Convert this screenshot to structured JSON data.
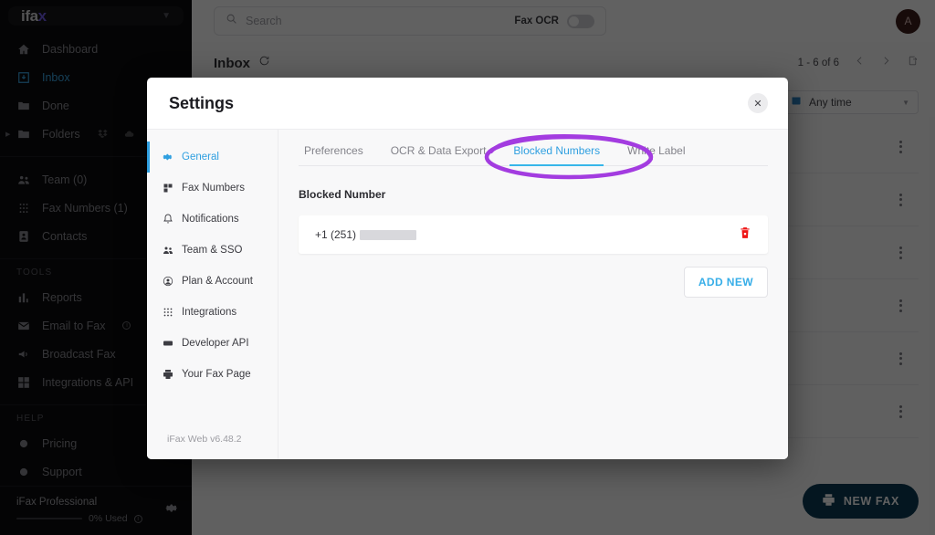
{
  "sidebar": {
    "logo": {
      "prefix": "ifa",
      "accent": "x",
      "chevron_icon": "chevron-down-icon"
    },
    "items": [
      {
        "label": "Dashboard",
        "icon": "home-icon",
        "active": false
      },
      {
        "label": "Inbox",
        "icon": "inbox-download-icon",
        "active": true
      },
      {
        "label": "Done",
        "icon": "folder-check-icon",
        "active": false
      },
      {
        "label": "Folders",
        "icon": "folder-icon",
        "active": false,
        "expandable": true,
        "badges": [
          "dropbox-icon",
          "cloud-icon"
        ]
      },
      {
        "label": "Team (0)",
        "icon": "team-icon",
        "active": false
      },
      {
        "label": "Fax Numbers (1)",
        "icon": "keypad-icon",
        "active": false
      },
      {
        "label": "Contacts",
        "icon": "contact-card-icon",
        "active": false
      }
    ],
    "tools_label": "TOOLS",
    "tools": [
      {
        "label": "Reports",
        "icon": "bar-chart-icon"
      },
      {
        "label": "Email to Fax",
        "icon": "envelope-icon",
        "info": true
      },
      {
        "label": "Broadcast Fax",
        "icon": "megaphone-icon"
      },
      {
        "label": "Integrations & API",
        "icon": "puzzle-icon"
      }
    ],
    "help_label": "HELP",
    "help": [
      {
        "label": "Pricing",
        "icon": "tag-icon"
      },
      {
        "label": "Support",
        "icon": "help-icon"
      }
    ],
    "plan": {
      "name": "iFax Professional",
      "usage": "0% Used",
      "settings_icon": "gear-icon",
      "info_icon": "info-icon"
    }
  },
  "topbar": {
    "search_placeholder": "Search",
    "search_icon": "search-icon",
    "ocr_label": "Fax OCR",
    "ocr_enabled": false,
    "avatar_initial": "A"
  },
  "inbox": {
    "title": "Inbox",
    "refresh_icon": "refresh-icon",
    "pagination": "1 - 6 of 6",
    "prev_icon": "chevron-left-icon",
    "next_icon": "chevron-right-icon",
    "export_icon": "export-icon",
    "date_filter": {
      "value": "Any time",
      "icon": "calendar-icon",
      "chevron": "chevron-down-icon"
    },
    "row_count": 6,
    "row_menu_icon": "kebab-menu-icon",
    "new_fax_label": "NEW FAX",
    "new_fax_icon": "fax-machine-icon"
  },
  "modal": {
    "title": "Settings",
    "close_icon": "close-icon",
    "nav": [
      {
        "label": "General",
        "icon": "gear-icon",
        "active": true
      },
      {
        "label": "Fax Numbers",
        "icon": "fax-numbers-icon",
        "active": false
      },
      {
        "label": "Notifications",
        "icon": "bell-icon",
        "active": false
      },
      {
        "label": "Team & SSO",
        "icon": "team-icon",
        "active": false
      },
      {
        "label": "Plan & Account",
        "icon": "user-circle-icon",
        "active": false
      },
      {
        "label": "Integrations",
        "icon": "grid-dots-icon",
        "active": false
      },
      {
        "label": "Developer API",
        "icon": "api-icon",
        "active": false
      },
      {
        "label": "Your Fax Page",
        "icon": "printer-icon",
        "active": false
      }
    ],
    "version": "iFax Web v6.48.2",
    "tabs": [
      {
        "label": "Preferences",
        "active": false
      },
      {
        "label": "OCR & Data Export",
        "active": false
      },
      {
        "label": "Blocked Numbers",
        "active": true
      },
      {
        "label": "White Label",
        "active": false
      }
    ],
    "blocked": {
      "section_label": "Blocked Number",
      "entries": [
        {
          "number_prefix": "+1 (251)",
          "redacted": true,
          "delete_icon": "trash-icon"
        }
      ],
      "add_label": "ADD NEW"
    }
  },
  "annotation": {
    "shape": "ellipse-highlight",
    "color": "#a33ce0",
    "target": "Blocked Numbers"
  },
  "colors": {
    "accent_blue": "#2f9fe0",
    "sidebar_bg": "#0d0d0f",
    "danger_red": "#ef1616",
    "new_fax_bg": "#0d3b55",
    "annotation_purple": "#a33ce0"
  }
}
